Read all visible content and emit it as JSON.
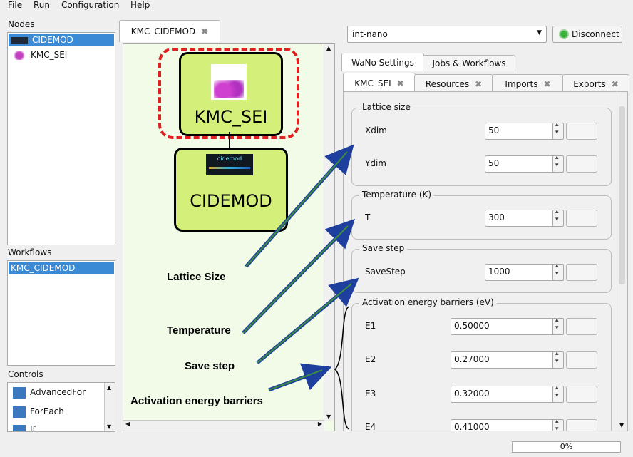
{
  "menu": [
    {
      "label": "File"
    },
    {
      "label": "Run"
    },
    {
      "label": "Configuration"
    },
    {
      "label": "Help"
    }
  ],
  "sections": {
    "nodes": "Nodes",
    "workflows": "Workflows",
    "controls": "Controls"
  },
  "nodes": [
    "CIDEMOD",
    "KMC_SEI"
  ],
  "workflows": [
    "KMC_CIDEMOD"
  ],
  "controls": [
    "AdvancedFor",
    "ForEach",
    "If"
  ],
  "editor_tab": "KMC_CIDEMOD",
  "canvas_nodes": {
    "top": "KMC_SEI",
    "bottom": "CIDEMOD",
    "logo_text": "cidemod"
  },
  "server": {
    "selected": "int-nano",
    "disconnect_label": "Disconnect",
    "status_color": "#3bb33b"
  },
  "right_tabs": [
    "WaNo Settings",
    "Jobs & Workflows"
  ],
  "wano_tabs": [
    "KMC_SEI",
    "Resources",
    "Imports",
    "Exports"
  ],
  "groups": [
    {
      "title": "Lattice size",
      "fields": [
        {
          "label": "Xdim",
          "value": "50"
        },
        {
          "label": "Ydim",
          "value": "50"
        }
      ]
    },
    {
      "title": "Temperature (K)",
      "fields": [
        {
          "label": "T",
          "value": "300"
        }
      ]
    },
    {
      "title": "Save step",
      "fields": [
        {
          "label": "SaveStep",
          "value": "1000"
        }
      ]
    },
    {
      "title": "Activation energy barriers (eV)",
      "fields": [
        {
          "label": "E1",
          "value": "0.50000"
        },
        {
          "label": "E2",
          "value": "0.27000"
        },
        {
          "label": "E3",
          "value": "0.32000"
        },
        {
          "label": "E4",
          "value": "0.41000"
        }
      ]
    }
  ],
  "annotations": [
    "Lattice Size",
    "Temperature",
    "Save step",
    "Activation energy barriers"
  ],
  "status": {
    "progress_text": "0%",
    "progress": 0
  },
  "colors": {
    "selection": "#3b8ad6",
    "node_fill": "#d5f07a",
    "highlight_dash": "#e02020",
    "arrow": "#3d8f3d"
  }
}
